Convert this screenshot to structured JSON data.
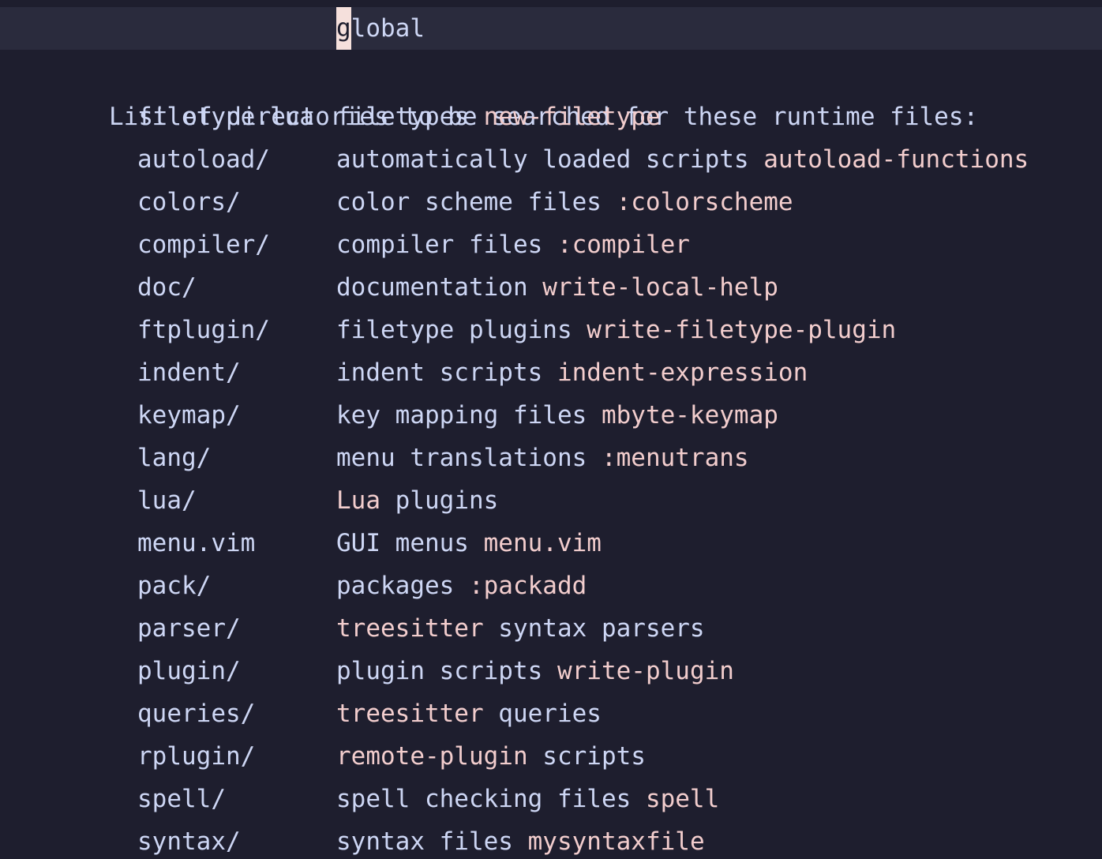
{
  "cursor_line": {
    "cursor_char": "g",
    "rest": "lobal"
  },
  "heading": "List of directories to be searched for these runtime files:",
  "colors": {
    "background": "#1e1e2e",
    "cursorline": "#2a2b3d",
    "text": "#cdd6f4",
    "tag": "#f2cdcd",
    "cursor": "#f5e0dc"
  },
  "rows": [
    {
      "name": "filetype.lua",
      "parts": [
        {
          "t": "filetypes ",
          "tag": false
        },
        {
          "t": "new-filetype",
          "tag": true
        }
      ]
    },
    {
      "name": "autoload/",
      "parts": [
        {
          "t": "automatically loaded scripts ",
          "tag": false
        },
        {
          "t": "autoload-functions",
          "tag": true
        }
      ]
    },
    {
      "name": "colors/",
      "parts": [
        {
          "t": "color scheme files ",
          "tag": false
        },
        {
          "t": ":colorscheme",
          "tag": true
        }
      ]
    },
    {
      "name": "compiler/",
      "parts": [
        {
          "t": "compiler files ",
          "tag": false
        },
        {
          "t": ":compiler",
          "tag": true
        }
      ]
    },
    {
      "name": "doc/",
      "parts": [
        {
          "t": "documentation ",
          "tag": false
        },
        {
          "t": "write-local-help",
          "tag": true
        }
      ]
    },
    {
      "name": "ftplugin/",
      "parts": [
        {
          "t": "filetype plugins ",
          "tag": false
        },
        {
          "t": "write-filetype-plugin",
          "tag": true
        }
      ]
    },
    {
      "name": "indent/",
      "parts": [
        {
          "t": "indent scripts ",
          "tag": false
        },
        {
          "t": "indent-expression",
          "tag": true
        }
      ]
    },
    {
      "name": "keymap/",
      "parts": [
        {
          "t": "key mapping files ",
          "tag": false
        },
        {
          "t": "mbyte-keymap",
          "tag": true
        }
      ]
    },
    {
      "name": "lang/",
      "parts": [
        {
          "t": "menu translations ",
          "tag": false
        },
        {
          "t": ":menutrans",
          "tag": true
        }
      ]
    },
    {
      "name": "lua/",
      "parts": [
        {
          "t": "Lua",
          "tag": true
        },
        {
          "t": " plugins",
          "tag": false
        }
      ]
    },
    {
      "name": "menu.vim",
      "parts": [
        {
          "t": "GUI menus ",
          "tag": false
        },
        {
          "t": "menu.vim",
          "tag": true
        }
      ]
    },
    {
      "name": "pack/",
      "parts": [
        {
          "t": "packages ",
          "tag": false
        },
        {
          "t": ":packadd",
          "tag": true
        }
      ]
    },
    {
      "name": "parser/",
      "parts": [
        {
          "t": "treesitter",
          "tag": true
        },
        {
          "t": " syntax parsers",
          "tag": false
        }
      ]
    },
    {
      "name": "plugin/",
      "parts": [
        {
          "t": "plugin scripts ",
          "tag": false
        },
        {
          "t": "write-plugin",
          "tag": true
        }
      ]
    },
    {
      "name": "queries/",
      "parts": [
        {
          "t": "treesitter",
          "tag": true
        },
        {
          "t": " queries",
          "tag": false
        }
      ]
    },
    {
      "name": "rplugin/",
      "parts": [
        {
          "t": "remote-plugin",
          "tag": true
        },
        {
          "t": " scripts",
          "tag": false
        }
      ]
    },
    {
      "name": "spell/",
      "parts": [
        {
          "t": "spell checking files ",
          "tag": false
        },
        {
          "t": "spell",
          "tag": true
        }
      ]
    },
    {
      "name": "syntax/",
      "parts": [
        {
          "t": "syntax files ",
          "tag": false
        },
        {
          "t": "mysyntaxfile",
          "tag": true
        }
      ]
    }
  ]
}
